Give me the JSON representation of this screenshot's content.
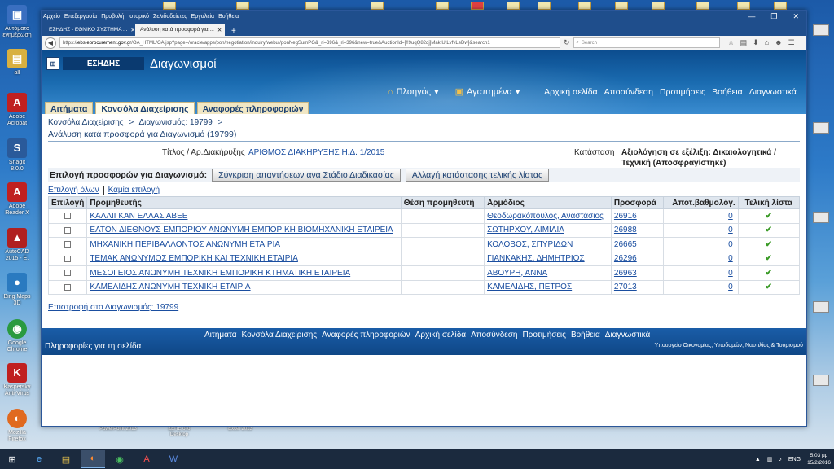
{
  "desktop": {
    "icons": [
      {
        "label": "Αυτόματο ενημέρωση",
        "icon": "computer-icon",
        "color": "#3a6fc0"
      },
      {
        "label": "all",
        "icon": "folder-icon",
        "color": "#d8b040"
      },
      {
        "label": "Adobe Acrobat",
        "icon": "acrobat-icon",
        "color": "#c02020"
      },
      {
        "label": "SnagIt 8.0.0",
        "icon": "snagit-icon",
        "color": "#2a5a9a"
      },
      {
        "label": "Adobe Reader X",
        "icon": "adobe-reader-icon",
        "color": "#c02020"
      },
      {
        "label": "AutoCAD 2015 - E.",
        "icon": "autocad-icon",
        "color": "#b02020"
      },
      {
        "label": "Bing Maps 3D",
        "icon": "bing-maps-icon",
        "color": "#2a7ac0"
      },
      {
        "label": "Google Chrome",
        "icon": "chrome-icon",
        "color": "#2a9a40"
      },
      {
        "label": "Kaspersky Anti-Virus",
        "icon": "kaspersky-icon",
        "color": "#c02020"
      },
      {
        "label": "Mozilla Firefox",
        "icon": "firefox-icon",
        "color": "#e06a20"
      }
    ],
    "bottom_icons": [
      "PowerPoint 2013",
      "ΣΕΠΕ στο Desktop",
      "Excel 2013"
    ]
  },
  "browser": {
    "menu": [
      "Αρχείο",
      "Επεξεργασία",
      "Προβολή",
      "Ιστορικό",
      "Σελιδοδείκτες",
      "Εργαλεία",
      "Βοήθεια"
    ],
    "tabs": [
      {
        "label": "ΕΣΗΔΗΣ - ΕΘΝΙΚΟ ΣΥΣΤΗΜΑ ...",
        "active": false
      },
      {
        "label": "Ανάλυση κατά προσφορά για ...",
        "active": true
      }
    ],
    "url_prefix": "https://",
    "url_host": "ebs.eprocurement.gov.gr",
    "url_path": "/OA_HTML/OA.jsp?page=/oracle/apps/pon/negotiation/inquiry/webui/ponNegSumPG&_ri=396&_ri=396&new=true&AuctionId=[!!9uqQ82dj]MaktUtLvfvLeDw]&search1",
    "search_placeholder": "Search"
  },
  "app": {
    "brand": "ΕΣΗΔΗΣ",
    "title": "Διαγωνισμοί",
    "nav": [
      {
        "label": "Πλοηγός",
        "icon": "home-icon"
      },
      {
        "label": "Αγαπημένα",
        "icon": "favorites-icon"
      }
    ],
    "global_links": [
      "Αρχική σελίδα",
      "Αποσύνδεση",
      "Προτιμήσεις",
      "Βοήθεια",
      "Διαγνωστικά"
    ],
    "main_tabs": [
      {
        "label": "Αιτήματα",
        "active": false
      },
      {
        "label": "Κονσόλα Διαχείρισης",
        "active": true
      },
      {
        "label": "Αναφορές πληροφοριών",
        "active": false
      }
    ],
    "breadcrumb": [
      "Κονσόλα Διαχείρισης",
      ">",
      "Διαγωνισμός: 19799",
      ">"
    ],
    "page_heading": "Ανάλυση κατά προσφορά για Διαγωνισμό (19799)",
    "info": {
      "title_label": "Τίτλος / Αρ.Διακήρυξης",
      "title_value": "ΑΡΙΘΜΟΣ ΔΙΑΚΗΡΥΞΗΣ Η.Δ. 1/2015",
      "status_label": "Κατάσταση",
      "status_value": "Αξιολόγηση σε εξέλιξη: Δικαιολογητικά / Τεχνική (Αποσφραγίστηκε)"
    },
    "actions": {
      "label": "Επιλογή προσφορών για Διαγωνισμό:",
      "compare_button": "Σύγκριση απαντήσεων ανα Στάδιο Διαδικασίας",
      "change_status_button": "Αλλαγή κατάστασης τελικής λίστας"
    },
    "select_all": "Επιλογή όλων",
    "select_none": "Καμία επιλογή",
    "table": {
      "headers": [
        "Επιλογή",
        "Προμηθευτής",
        "Θέση προμηθευτή",
        "Αρμόδιος",
        "Προσφορά",
        "Αποτ.βαθμολόγ.",
        "Τελική λίστα"
      ],
      "rows": [
        {
          "supplier": "ΚΑΛΛΙΓΚΑΝ ΕΛΛΑΣ ΑΒΕΕ",
          "site": "",
          "contact": "Θεοδωρακόπουλος, Αναστάσιος",
          "bid": "26916",
          "score": "0",
          "final": "✔"
        },
        {
          "supplier": "ΕΛΤΟΝ ΔΙΕΘΝΟΥΣ ΕΜΠΟΡΙΟΥ ΑΝΩΝΥΜΗ ΕΜΠΟΡΙΚΗ ΒΙΟΜΗΧΑΝΙΚΗ ΕΤΑΙΡΕΙΑ",
          "site": "",
          "contact": "ΣΩΤΗΡΧΟΥ, ΑΙΜΙΛΙΑ",
          "bid": "26988",
          "score": "0",
          "final": "✔"
        },
        {
          "supplier": "ΜΗΧΑΝΙΚΗ ΠΕΡΙΒΑΛΛΟΝΤΟΣ ΑΝΩΝΥΜΗ ΕΤΑΙΡΙΑ",
          "site": "",
          "contact": "ΚΟΛΟΒΟΣ, ΣΠΥΡΙΔΩΝ",
          "bid": "26665",
          "score": "0",
          "final": "✔"
        },
        {
          "supplier": "ΤΕΜΑΚ ΑΝΩΝΥΜΟΣ ΕΜΠΟΡΙΚΗ ΚΑΙ ΤΕΧΝΙΚΗ ΕΤΑΙΡΙΑ",
          "site": "",
          "contact": "ΓΙΑΝΚΑΚΗΣ, ΔΗΜΗΤΡΙΟΣ",
          "bid": "26296",
          "score": "0",
          "final": "✔"
        },
        {
          "supplier": "ΜΕΣΟΓΕΙΟΣ ΑΝΩΝΥΜΗ ΤΕΧΝΙΚΗ ΕΜΠΟΡΙΚΗ ΚΤΗΜΑΤΙΚΗ ΕΤΑΙΡΕΙΑ",
          "site": "",
          "contact": "ΑΒΟΥΡΗ, ΑΝΝΑ",
          "bid": "26963",
          "score": "0",
          "final": "✔"
        },
        {
          "supplier": "ΚΑΜΕΛΙΔΗΣ ΑΝΩΝΥΜΗ ΤΕΧΝΙΚΗ ΕΤΑΙΡΙΑ",
          "site": "",
          "contact": "ΚΑΜΕΛΙΔΗΣ, ΠΕΤΡΟΣ",
          "bid": "27013",
          "score": "0",
          "final": "✔"
        }
      ]
    },
    "return_link": "Επιστροφή στο Διαγωνισμός: 19799",
    "footer_links": [
      "Αιτήματα",
      "Κονσόλα Διαχείρισης",
      "Αναφορές πληροφοριών",
      "Αρχική σελίδα",
      "Αποσύνδεση",
      "Προτιμήσεις",
      "Βοήθεια",
      "Διαγνωστικά"
    ],
    "footer_info": "Πληροφορίες για τη σελίδα",
    "footer_ministry": "Υπουργείο Οικονομίας, Υποδομών, Ναυτιλίας & Τουρισμού"
  },
  "taskbar": {
    "items": [
      "windows-start-icon",
      "ie-icon",
      "explorer-icon",
      "firefox-icon",
      "chrome-icon",
      "acrobat-icon",
      "word-icon"
    ],
    "language": "ENG",
    "time": "5:03 μμ",
    "date": "15/2/2016"
  }
}
